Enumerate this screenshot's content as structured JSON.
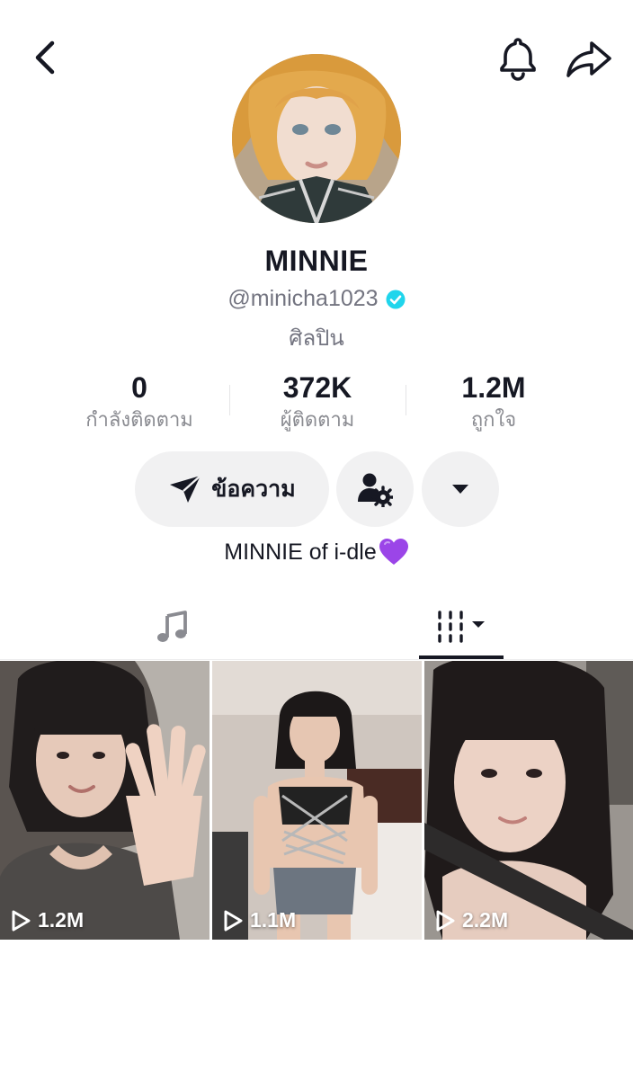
{
  "profile": {
    "display_name": "MINNIE",
    "username": "@minicha1023",
    "category": "ศิลปิน",
    "bio": "MINNIE of i-dle",
    "bio_emoji": "💜"
  },
  "stats": [
    {
      "value": "0",
      "label": "กำลังติดตาม"
    },
    {
      "value": "372K",
      "label": "ผู้ติดตาม"
    },
    {
      "value": "1.2M",
      "label": "ถูกใจ"
    }
  ],
  "actions": {
    "message_label": "ข้อความ"
  },
  "icons": {
    "back": "chevron-left-icon",
    "bell": "bell-icon",
    "share": "share-arrow-icon",
    "verified": "verified-badge-icon",
    "message": "send-icon",
    "follow_settings": "person-gear-icon",
    "more": "caret-down-icon",
    "tab_music": "music-note-icon",
    "tab_videos": "grid-icon"
  },
  "videos": [
    {
      "plays": "1.2M"
    },
    {
      "plays": "1.1M"
    },
    {
      "plays": "2.2M"
    }
  ],
  "colors": {
    "verified": "#20d5ec",
    "button_bg": "#f1f1f2",
    "muted_text": "#737480",
    "text": "#161823"
  }
}
